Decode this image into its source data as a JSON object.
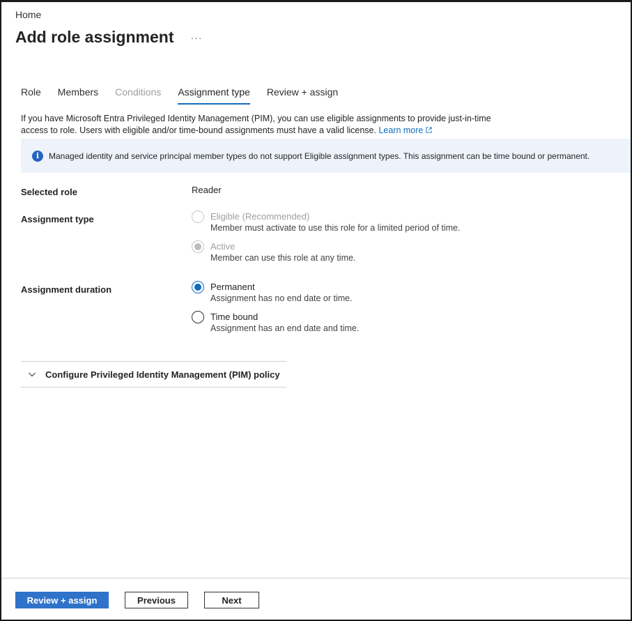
{
  "breadcrumb": "Home",
  "page": {
    "title": "Add role assignment",
    "more": "···"
  },
  "tabs": [
    {
      "label": "Role",
      "state": "enabled"
    },
    {
      "label": "Members",
      "state": "enabled"
    },
    {
      "label": "Conditions",
      "state": "disabled"
    },
    {
      "label": "Assignment type",
      "state": "selected"
    },
    {
      "label": "Review + assign",
      "state": "enabled"
    }
  ],
  "intro": {
    "text": "If you have Microsoft Entra Privileged Identity Management (PIM), you can use eligible assignments to provide just-in-time access to role. Users with eligible and/or time-bound assignments must have a valid license.",
    "link": "Learn more"
  },
  "info_bar": {
    "icon": "info-icon",
    "text": "Managed identity and service principal member types do not support Eligible assignment types. This assignment can be time bound or permanent."
  },
  "selected_role": {
    "label": "Selected role",
    "value": "Reader"
  },
  "assignment_type": {
    "label": "Assignment type",
    "options": [
      {
        "label": "Eligible (Recommended)",
        "description": "Member must activate to use this role for a limited period of time.",
        "disabled": true,
        "checked": false
      },
      {
        "label": "Active",
        "description": "Member can use this role at any time.",
        "disabled": true,
        "checked": true
      }
    ]
  },
  "assignment_duration": {
    "label": "Assignment duration",
    "options": [
      {
        "label": "Permanent",
        "description": "Assignment has no end date or time.",
        "checked": true
      },
      {
        "label": "Time bound",
        "description": "Assignment has an end date and time.",
        "checked": false
      }
    ]
  },
  "accordion": {
    "label": "Configure Privileged Identity Management (PIM) policy",
    "expanded": false
  },
  "footer": {
    "primary": "Review + assign",
    "previous": "Previous",
    "next": "Next"
  },
  "colors": {
    "accent": "#0f6cbd",
    "primary_button": "#2f72c9",
    "info_bg": "#eef3fb",
    "disabled_text": "#a19f9d"
  }
}
